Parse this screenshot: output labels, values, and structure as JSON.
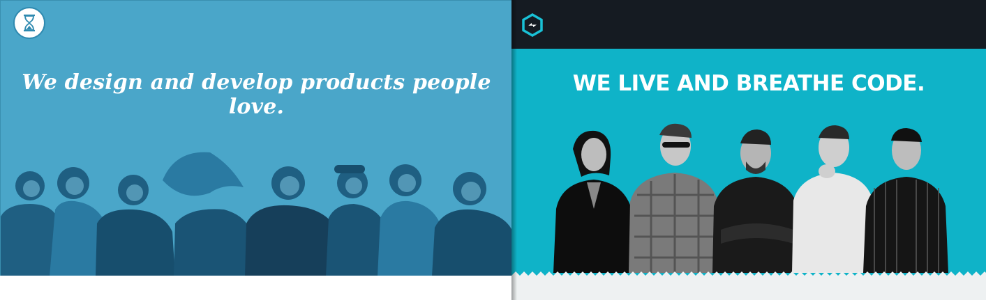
{
  "left_site": {
    "logo_icon": "hourglass-icon",
    "tagline": "We design and develop products people love.",
    "colors": {
      "hero": "#4aa6c9",
      "people": "#1d5f82"
    },
    "team_photo_people_count": 8
  },
  "right_site": {
    "logo_icon": "hexagon-arrow-icon",
    "headline": "WE LIVE AND BREATHE CODE.",
    "colors": {
      "topbar": "#151b22",
      "hero": "#0fb3c8",
      "footer": "#eef1f2"
    },
    "team_photo_people_count": 5
  }
}
